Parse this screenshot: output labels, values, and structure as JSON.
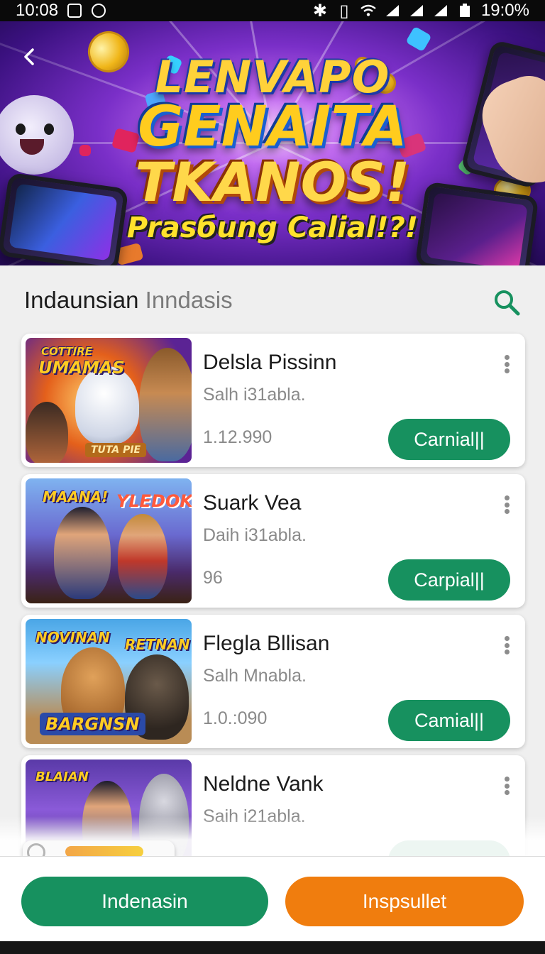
{
  "status_bar": {
    "time": "10:08",
    "battery_text": "19:0%"
  },
  "banner": {
    "line1": "LENVAPO",
    "line2": "GENAITA",
    "line3": "TKANOS!",
    "line4": "Prasбung Calial!?!"
  },
  "section": {
    "title": "Indaunsian",
    "subtitle": "Inndasis"
  },
  "cards": [
    {
      "title": "Delsla Pissinn",
      "subtitle": "Salh i31abla.",
      "count": "1.12.990",
      "button": "Carnial||",
      "thumb_text_1": "COTTIRE",
      "thumb_text_2": "UMAMAS",
      "thumb_text_3": "TUTA PIE"
    },
    {
      "title": "Suark Vea",
      "subtitle": "Daih i31abla.",
      "count": "96",
      "button": "Carpial||",
      "thumb_text_1": "MAANA!",
      "thumb_text_2": "YLEDOK",
      "thumb_text_3": ""
    },
    {
      "title": "Flegla Bllisan",
      "subtitle": "Salh Mnabla.",
      "count": "1.0.:090",
      "button": "Camial||",
      "thumb_text_1": "NOVINAN",
      "thumb_text_2": "RETNAN",
      "thumb_text_3": "BARGNSN"
    },
    {
      "title": "Neldne Vank",
      "subtitle": "Saih i21abla.",
      "count": "",
      "button": "",
      "thumb_text_1": "BLAIAN",
      "thumb_text_2": "",
      "thumb_text_3": ""
    }
  ],
  "bottom": {
    "primary_label": "Indenasin",
    "secondary_label": "Inspsullet"
  },
  "colors": {
    "accent_green": "#17915f",
    "accent_orange": "#f07d0e"
  }
}
